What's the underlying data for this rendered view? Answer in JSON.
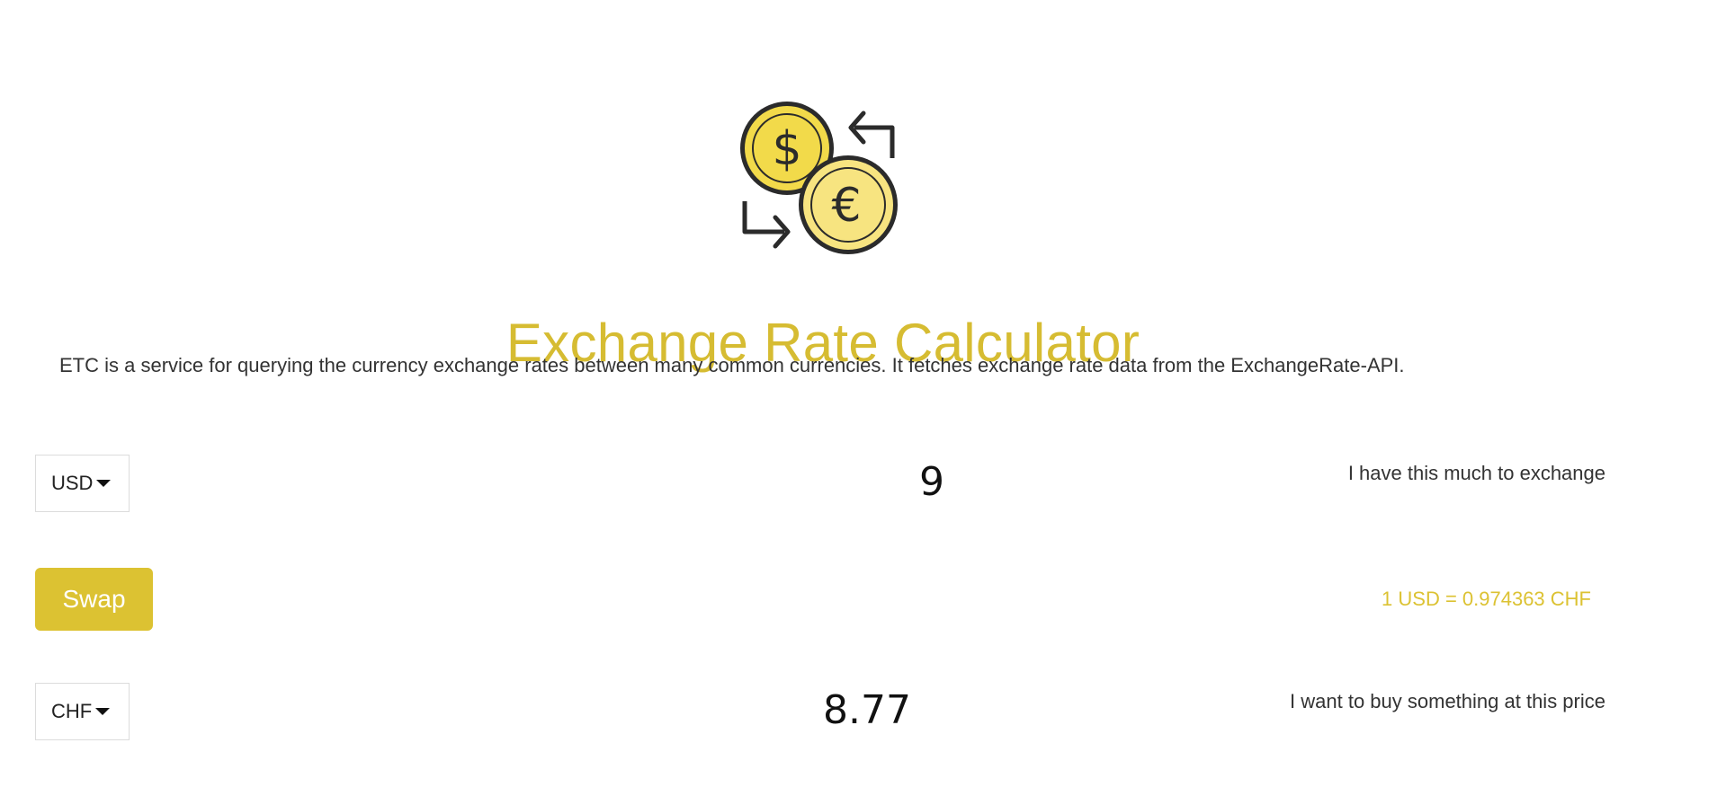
{
  "header": {
    "logo_icon": "currency-exchange-icon",
    "title": "Exchange Rate Calculator",
    "description": "ETC is a service for querying the currency exchange rates between many common currencies. It fetches exchange rate data from the ExchangeRate-API."
  },
  "from": {
    "currency": "USD",
    "amount": "9",
    "caption": "I have this much to exchange"
  },
  "swap": {
    "label": "Swap",
    "rate_text": "1 USD = 0.974363 CHF"
  },
  "to": {
    "currency": "CHF",
    "amount": "8.77",
    "caption": "I want to buy something at this price"
  },
  "colors": {
    "accent": "#dcc232",
    "coin_dollar": "#f2da4a",
    "coin_euro": "#f7e480",
    "outline": "#2b2b2b"
  }
}
